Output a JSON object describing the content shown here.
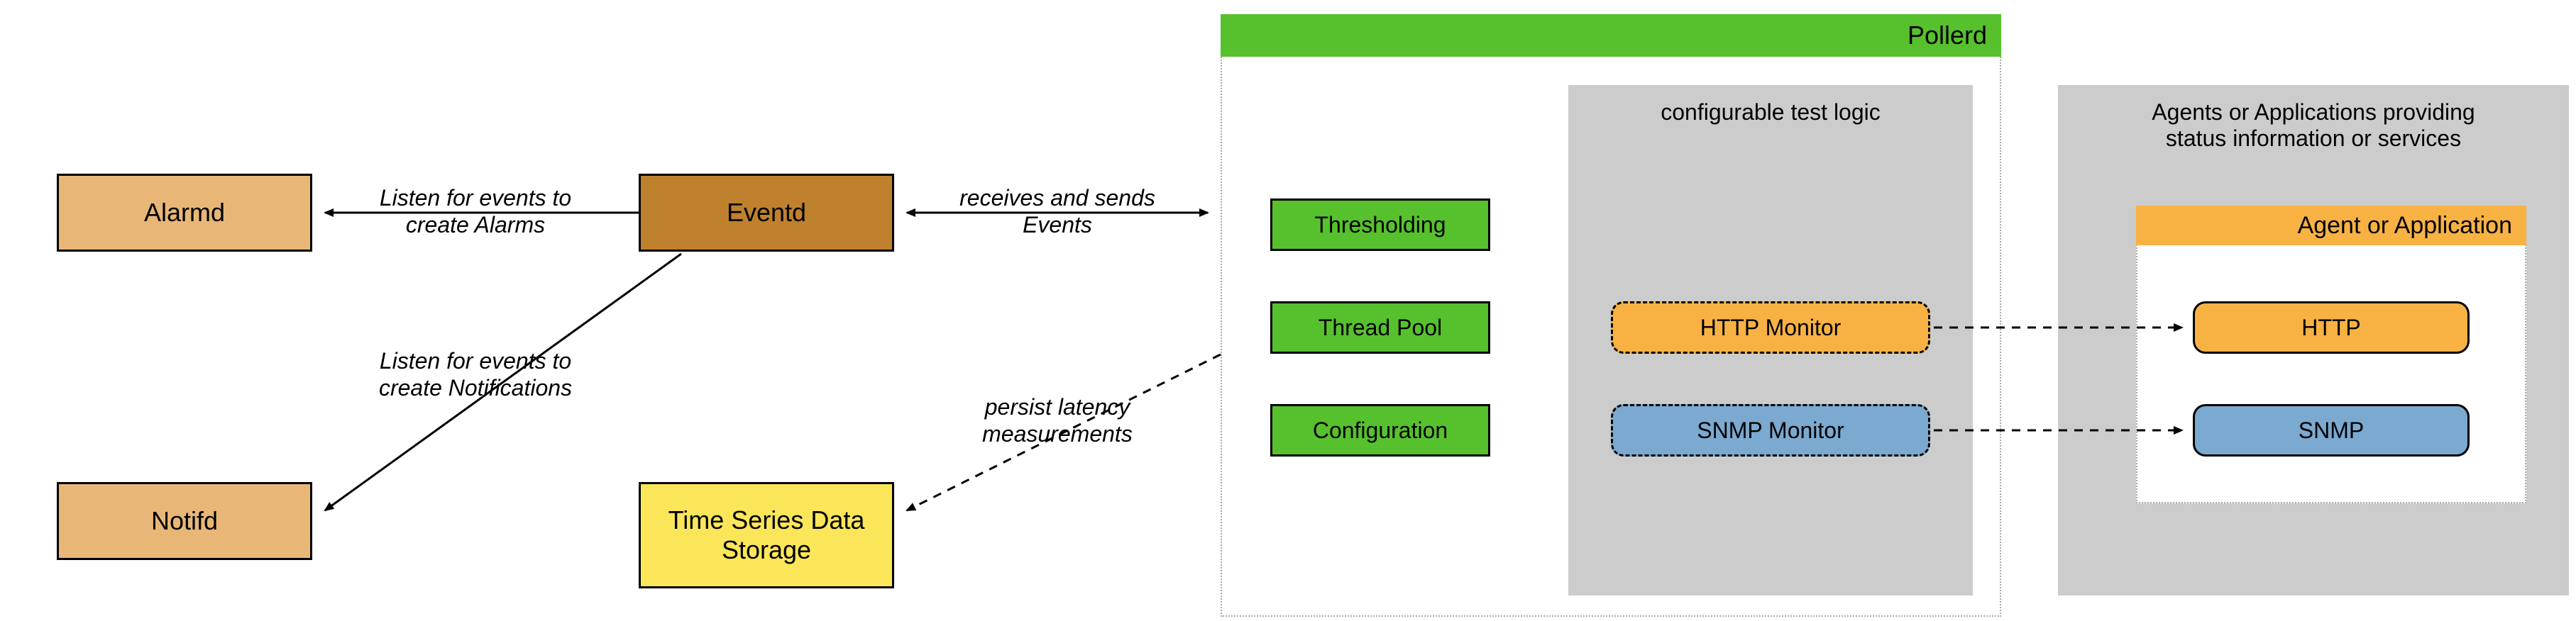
{
  "alarmd": {
    "label": "Alarmd"
  },
  "notifd": {
    "label": "Notifd"
  },
  "eventd": {
    "label": "Eventd"
  },
  "tsds": {
    "label": "Time Series Data Storage"
  },
  "edge_alarms": "Listen for events to\ncreate Alarms",
  "edge_notifications": "Listen for events to\ncreate Notifications",
  "edge_events": "receives and sends\nEvents",
  "edge_persist": "persist latency\nmeasurements",
  "pollerd": {
    "title": "Pollerd",
    "thresholding": "Thresholding",
    "threadpool": "Thread Pool",
    "configuration": "Configuration",
    "test_logic_label": "configurable test logic",
    "http_monitor": "HTTP Monitor",
    "snmp_monitor": "SNMP Monitor"
  },
  "agents": {
    "panel_label": "Agents or Applications providing\nstatus information or services",
    "title": "Agent or Application",
    "http": "HTTP",
    "snmp": "SNMP"
  }
}
